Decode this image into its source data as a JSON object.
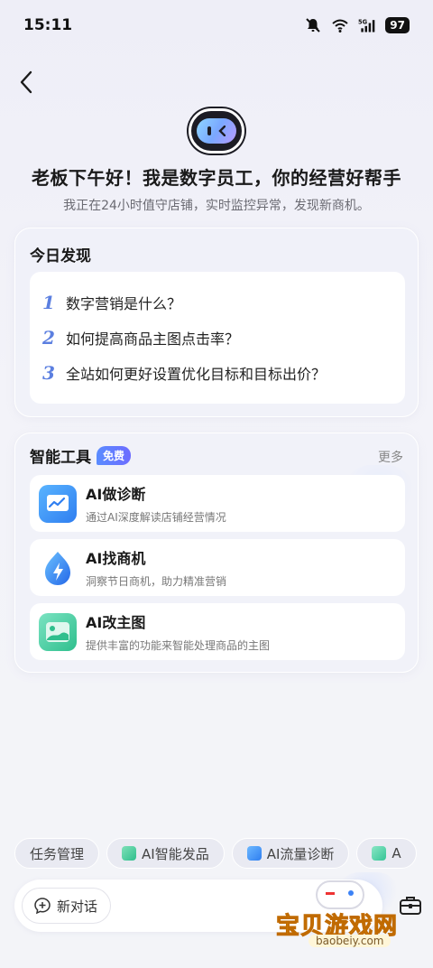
{
  "status_bar": {
    "time": "15:11",
    "battery": "97",
    "network": "5G"
  },
  "header": {
    "greeting": "老板下午好！我是数字员工，你的经营好帮手",
    "subtitle": "我正在24小时值守店铺，实时监控异常，发现新商机。"
  },
  "today": {
    "title": "今日发现",
    "questions": [
      {
        "num": "1",
        "text": "数字营销是什么？"
      },
      {
        "num": "2",
        "text": "如何提高商品主图点击率？"
      },
      {
        "num": "3",
        "text": "全站如何更好设置优化目标和目标出价？"
      }
    ]
  },
  "tools": {
    "title": "智能工具",
    "badge": "免费",
    "more": "更多",
    "items": [
      {
        "name": "AI做诊断",
        "desc": "通过AI深度解读店铺经营情况",
        "icon": "diagnosis-chart-icon",
        "color": "#3d8bf5"
      },
      {
        "name": "AI找商机",
        "desc": "洞察节日商机，助力精准营销",
        "icon": "lightning-drop-icon",
        "color": "#2f7ef0"
      },
      {
        "name": "AI改主图",
        "desc": "提供丰富的功能来智能处理商品的主图",
        "icon": "image-landscape-icon",
        "color": "#35c596"
      }
    ]
  },
  "chips": [
    {
      "label": "任务管理",
      "icon": ""
    },
    {
      "label": "AI智能发品",
      "icon": "sparkle-bag-icon"
    },
    {
      "label": "AI流量诊断",
      "icon": "traffic-chart-icon"
    },
    {
      "label": "A",
      "icon": "image-icon"
    }
  ],
  "input": {
    "new_chat": "新对话"
  },
  "watermark": {
    "text": "宝贝游戏网",
    "url": "baobeiy.com"
  },
  "colors": {
    "accent": "#5b7fe0",
    "badge_gradient_start": "#5a8cff",
    "badge_gradient_end": "#6d6cff"
  }
}
